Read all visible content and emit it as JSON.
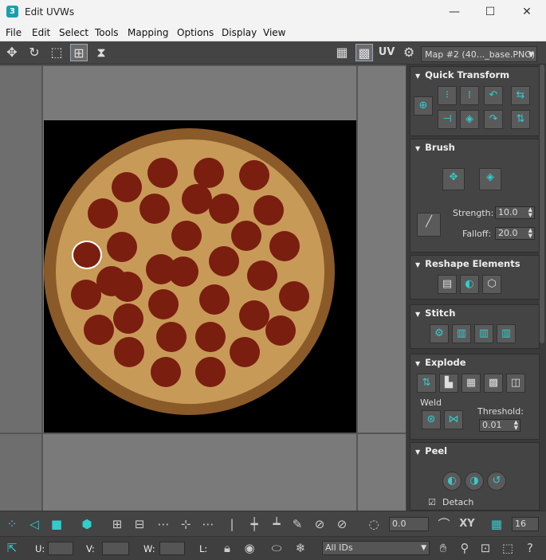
{
  "window": {
    "title": "Edit UVWs",
    "icon_text": "3",
    "minimize": "—",
    "maximize": "☐",
    "close": "✕"
  },
  "menu": [
    "File",
    "Edit",
    "Select",
    "Tools",
    "Mapping",
    "Options",
    "Display",
    "View"
  ],
  "toolbar": {
    "uv_label": "UV",
    "map_select": "Map #2 (40..._base.PNG)"
  },
  "panel": {
    "quick_transform": {
      "title": "Quick Transform"
    },
    "brush": {
      "title": "Brush",
      "strength_label": "Strength:",
      "strength_value": "10.0",
      "falloff_label": "Falloff:",
      "falloff_value": "20.0"
    },
    "reshape": {
      "title": "Reshape Elements"
    },
    "stitch": {
      "title": "Stitch"
    },
    "explode": {
      "title": "Explode",
      "weld_label": "Weld",
      "threshold_label": "Threshold:",
      "threshold_value": "0.01"
    },
    "peel": {
      "title": "Peel",
      "detach_label": "Detach"
    }
  },
  "bottom": {
    "offset_value": "0.0",
    "xy_label": "XY",
    "zoom_value": "16",
    "u_label": "U:",
    "v_label": "V:",
    "w_label": "W:",
    "l_label": "L:",
    "ids_select": "All IDs"
  },
  "colors": {
    "accent": "#33cccc",
    "panel_bg": "#444444"
  }
}
